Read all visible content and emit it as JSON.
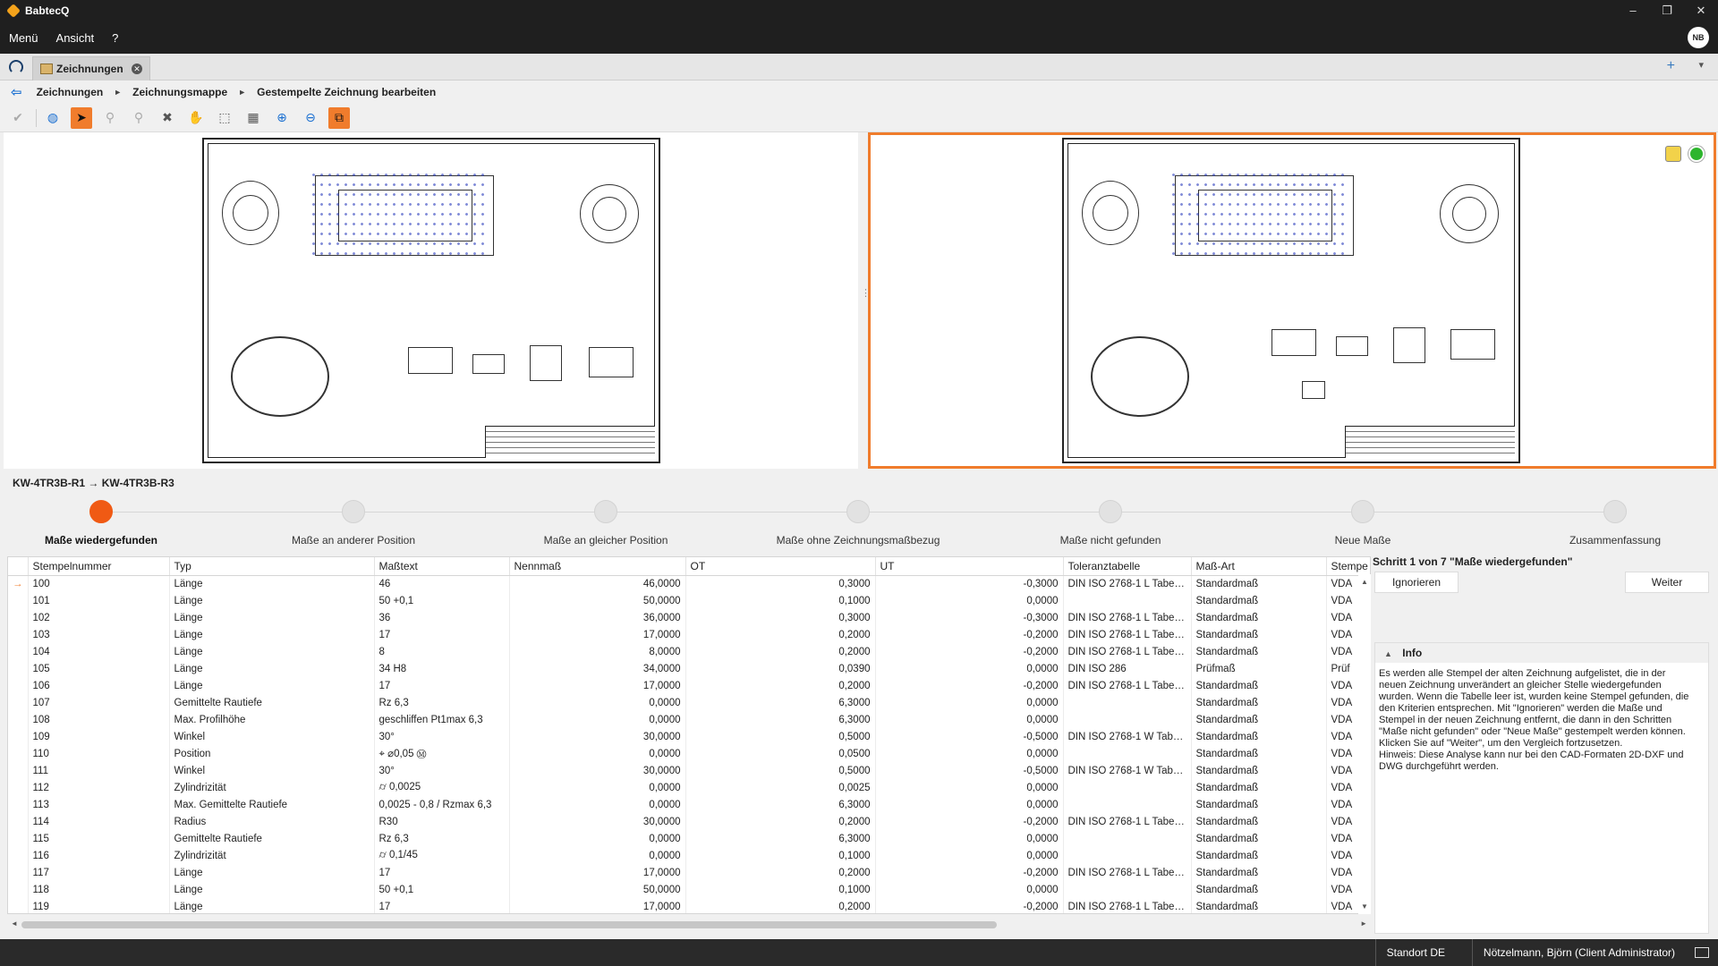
{
  "app": {
    "title": "BabtecQ",
    "avatar": "NB"
  },
  "menu": {
    "items": [
      "Menü",
      "Ansicht",
      "?"
    ]
  },
  "tabs": [
    {
      "label": "Zeichnungen"
    }
  ],
  "breadcrumb": [
    "Zeichnungen",
    "Zeichnungsmappe",
    "Gestempelte Zeichnung bearbeiten"
  ],
  "compare": {
    "label": "KW-4TR3B-R1 → KW-4TR3B-R3"
  },
  "steps": [
    {
      "label": "Maße wiedergefunden",
      "active": true
    },
    {
      "label": "Maße an anderer Position"
    },
    {
      "label": "Maße an gleicher Position"
    },
    {
      "label": "Maße ohne Zeichnungsmaßbezug"
    },
    {
      "label": "Maße nicht gefunden"
    },
    {
      "label": "Neue Maße"
    },
    {
      "label": "Zusammenfassung"
    }
  ],
  "table": {
    "columns": [
      "Stempelnummer",
      "Typ",
      "Maßtext",
      "Nennmaß",
      "OT",
      "UT",
      "Toleranztabelle",
      "Maß-Art",
      "Stempe"
    ],
    "rows": [
      [
        "100",
        "Länge",
        "46",
        "46,0000",
        "0,3000",
        "-0,3000",
        "DIN ISO 2768-1 L Tabelle...",
        "Standardmaß",
        "VDA"
      ],
      [
        "101",
        "Länge",
        "50 +0,1",
        "50,0000",
        "0,1000",
        "0,0000",
        "",
        "Standardmaß",
        "VDA"
      ],
      [
        "102",
        "Länge",
        "36",
        "36,0000",
        "0,3000",
        "-0,3000",
        "DIN ISO 2768-1 L Tabelle...",
        "Standardmaß",
        "VDA"
      ],
      [
        "103",
        "Länge",
        "17",
        "17,0000",
        "0,2000",
        "-0,2000",
        "DIN ISO 2768-1 L Tabelle...",
        "Standardmaß",
        "VDA"
      ],
      [
        "104",
        "Länge",
        "8",
        "8,0000",
        "0,2000",
        "-0,2000",
        "DIN ISO 2768-1 L Tabelle...",
        "Standardmaß",
        "VDA"
      ],
      [
        "105",
        "Länge",
        "34 H8",
        "34,0000",
        "0,0390",
        "0,0000",
        "DIN ISO 286",
        "Prüfmaß",
        "Prüf"
      ],
      [
        "106",
        "Länge",
        "17",
        "17,0000",
        "0,2000",
        "-0,2000",
        "DIN ISO 2768-1 L Tabelle...",
        "Standardmaß",
        "VDA"
      ],
      [
        "107",
        "Gemittelte Rautiefe",
        "Rz 6,3",
        "0,0000",
        "6,3000",
        "0,0000",
        "",
        "Standardmaß",
        "VDA"
      ],
      [
        "108",
        "Max. Profilhöhe",
        "geschliffen Pt1max 6,3",
        "0,0000",
        "6,3000",
        "0,0000",
        "",
        "Standardmaß",
        "VDA"
      ],
      [
        "109",
        "Winkel",
        "30°",
        "30,0000",
        "0,5000",
        "-0,5000",
        "DIN ISO 2768-1 W Tabell...",
        "Standardmaß",
        "VDA"
      ],
      [
        "110",
        "Position",
        "⌖ ⌀0,05 Ⓜ",
        "0,0000",
        "0,0500",
        "0,0000",
        "",
        "Standardmaß",
        "VDA"
      ],
      [
        "111",
        "Winkel",
        "30°",
        "30,0000",
        "0,5000",
        "-0,5000",
        "DIN ISO 2768-1 W Tabell...",
        "Standardmaß",
        "VDA"
      ],
      [
        "112",
        "Zylindrizität",
        "⌭ 0,0025",
        "0,0000",
        "0,0025",
        "0,0000",
        "",
        "Standardmaß",
        "VDA"
      ],
      [
        "113",
        "Max. Gemittelte Rautiefe",
        "0,0025 - 0,8 / Rzmax 6,3",
        "0,0000",
        "6,3000",
        "0,0000",
        "",
        "Standardmaß",
        "VDA"
      ],
      [
        "114",
        "Radius",
        "R30",
        "30,0000",
        "0,2000",
        "-0,2000",
        "DIN ISO 2768-1 L Tabelle...",
        "Standardmaß",
        "VDA"
      ],
      [
        "115",
        "Gemittelte Rautiefe",
        "Rz 6,3",
        "0,0000",
        "6,3000",
        "0,0000",
        "",
        "Standardmaß",
        "VDA"
      ],
      [
        "116",
        "Zylindrizität",
        "⌭ 0,1/45",
        "0,0000",
        "0,1000",
        "0,0000",
        "",
        "Standardmaß",
        "VDA"
      ],
      [
        "117",
        "Länge",
        "17",
        "17,0000",
        "0,2000",
        "-0,2000",
        "DIN ISO 2768-1 L Tabelle...",
        "Standardmaß",
        "VDA"
      ],
      [
        "118",
        "Länge",
        "50 +0,1",
        "50,0000",
        "0,1000",
        "0,0000",
        "",
        "Standardmaß",
        "VDA"
      ],
      [
        "119",
        "Länge",
        "17",
        "17,0000",
        "0,2000",
        "-0,2000",
        "DIN ISO 2768-1 L Tabelle...",
        "Standardmaß",
        "VDA"
      ]
    ]
  },
  "panel": {
    "step_title": "Schritt 1 von 7 \"Maße wiedergefunden\"",
    "ignore_label": "Ignorieren",
    "next_label": "Weiter",
    "info_title": "Info",
    "info_lines": [
      "Es werden alle Stempel der alten Zeichnung aufgelistet, die in der neuen Zeichnung unverändert an gleicher Stelle wiedergefunden wurden. Wenn die Tabelle leer ist, wurden keine Stempel gefunden, die den Kriterien entsprechen. Mit \"Ignorieren\" werden die Maße und Stempel in der neuen Zeichnung entfernt, die dann in den Schritten \"Maße nicht gefunden\" oder \"Neue Maße\" gestempelt werden können.",
      "Klicken Sie auf \"Weiter\", um den Vergleich fortzusetzen.",
      "Hinweis: Diese Analyse kann nur bei den CAD-Formaten 2D-DXF und DWG durchgeführt werden."
    ]
  },
  "status": {
    "location": "Standort DE",
    "user": "Nötzelmann, Björn (Client Administrator)"
  },
  "colors": {
    "accent": "#f07c2c",
    "active_step": "#f05a14",
    "ok": "#2db52d"
  }
}
